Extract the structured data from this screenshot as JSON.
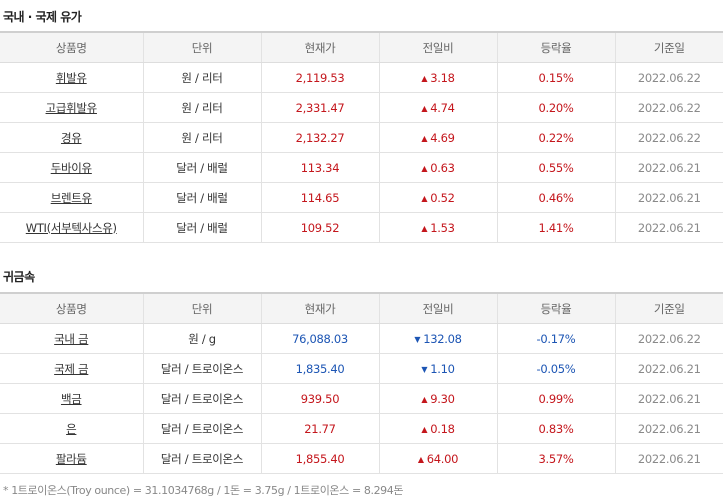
{
  "oil": {
    "title": "국내 · 국제 유가",
    "headers": [
      "상품명",
      "단위",
      "현재가",
      "전일비",
      "등락율",
      "기준일"
    ],
    "rows": [
      {
        "name": "휘발유",
        "unit": "원 / 리터",
        "price": "2,119.53",
        "change": "3.18",
        "dir": "up",
        "rate": "0.15%",
        "date": "2022.06.22"
      },
      {
        "name": "고급휘발유",
        "unit": "원 / 리터",
        "price": "2,331.47",
        "change": "4.74",
        "dir": "up",
        "rate": "0.20%",
        "date": "2022.06.22"
      },
      {
        "name": "경유",
        "unit": "원 / 리터",
        "price": "2,132.27",
        "change": "4.69",
        "dir": "up",
        "rate": "0.22%",
        "date": "2022.06.22"
      },
      {
        "name": "두바이유",
        "unit": "달러 / 배럴",
        "price": "113.34",
        "change": "0.63",
        "dir": "up",
        "rate": "0.55%",
        "date": "2022.06.21"
      },
      {
        "name": "브렌트유",
        "unit": "달러 / 배럴",
        "price": "114.65",
        "change": "0.52",
        "dir": "up",
        "rate": "0.46%",
        "date": "2022.06.21"
      },
      {
        "name": "WTI(서부텍사스유)",
        "unit": "달러 / 배럴",
        "price": "109.52",
        "change": "1.53",
        "dir": "up",
        "rate": "1.41%",
        "date": "2022.06.21"
      }
    ]
  },
  "metal": {
    "title": "귀금속",
    "headers": [
      "상품명",
      "단위",
      "현재가",
      "전일비",
      "등락율",
      "기준일"
    ],
    "rows": [
      {
        "name": "국내 금",
        "unit": "원 / g",
        "price": "76,088.03",
        "change": "132.08",
        "dir": "down",
        "rate": "-0.17%",
        "date": "2022.06.22"
      },
      {
        "name": "국제 금",
        "unit": "달러 / 트로이온스",
        "price": "1,835.40",
        "change": "1.10",
        "dir": "down",
        "rate": "-0.05%",
        "date": "2022.06.21"
      },
      {
        "name": "백금",
        "unit": "달러 / 트로이온스",
        "price": "939.50",
        "change": "9.30",
        "dir": "up",
        "rate": "0.99%",
        "date": "2022.06.21"
      },
      {
        "name": "은",
        "unit": "달러 / 트로이온스",
        "price": "21.77",
        "change": "0.18",
        "dir": "up",
        "rate": "0.83%",
        "date": "2022.06.21"
      },
      {
        "name": "팔라듐",
        "unit": "달러 / 트로이온스",
        "price": "1,855.40",
        "change": "64.00",
        "dir": "up",
        "rate": "3.57%",
        "date": "2022.06.21"
      }
    ]
  },
  "arrows": {
    "up": "▲",
    "down": "▼"
  },
  "colors": {
    "up": "#c4161c",
    "down": "#1c55b4"
  },
  "footnote": "* 1트로이온스(Troy ounce) = 31.1034768g / 1돈 = 3.75g / 1트로이온스 = 8.294돈"
}
